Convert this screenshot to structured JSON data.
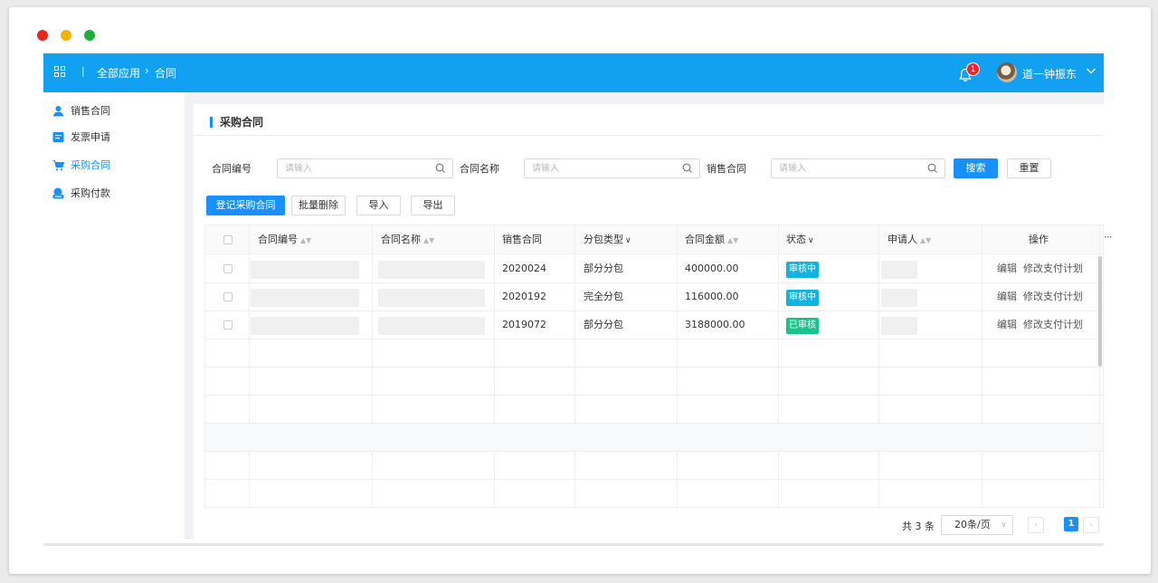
{
  "window": {
    "controls": [
      "close",
      "minimize",
      "maximize"
    ]
  },
  "topbar": {
    "breadcrumb": {
      "separator": "|",
      "all": "全部应用",
      "arrow": "›",
      "current": "合同"
    },
    "notifications": {
      "count": "1"
    },
    "user": {
      "name": "道一钟振东"
    },
    "colors": {
      "bar": "#12a0f0"
    }
  },
  "sidebar": {
    "items": [
      {
        "label": "销售合同",
        "icon": "user-icon",
        "active": false
      },
      {
        "label": "发票申请",
        "icon": "invoice-icon",
        "active": false
      },
      {
        "label": "采购合同",
        "icon": "cart-icon",
        "active": true
      },
      {
        "label": "采购付款",
        "icon": "payment-icon",
        "active": false
      }
    ]
  },
  "main": {
    "title": "采购合同",
    "filters": [
      {
        "label": "合同编号",
        "placeholder": "请输入",
        "value": ""
      },
      {
        "label": "合同名称",
        "placeholder": "请输入",
        "value": ""
      },
      {
        "label": "销售合同",
        "placeholder": "请输入",
        "value": ""
      }
    ],
    "search_label": "搜索",
    "reset_label": "重置",
    "toolbar": {
      "register": "登记采购合同",
      "batch_delete": "批量删除",
      "import": "导入",
      "export": "导出"
    },
    "table": {
      "columns": [
        "合同编号",
        "合同名称",
        "销售合同",
        "分包类型",
        "合同金额",
        "状态",
        "申请人",
        "操作"
      ],
      "rows": [
        {
          "sales_contract": "2020024",
          "subcontract_type": "部分分包",
          "amount": "400000.00",
          "status": "审核中",
          "status_kind": "pending"
        },
        {
          "sales_contract": "2020192",
          "subcontract_type": "完全分包",
          "amount": "116000.00",
          "status": "审核中",
          "status_kind": "pending"
        },
        {
          "sales_contract": "2019072",
          "subcontract_type": "部分分包",
          "amount": "3188000.00",
          "status": "已审核",
          "status_kind": "done"
        }
      ],
      "actions": {
        "edit": "编辑",
        "modify_plan": "修改支付计划"
      },
      "more": "···"
    },
    "pagination": {
      "total": "共 3 条",
      "page_size": "20条/页",
      "current_page": "1",
      "prev": "‹",
      "next": "›"
    }
  }
}
